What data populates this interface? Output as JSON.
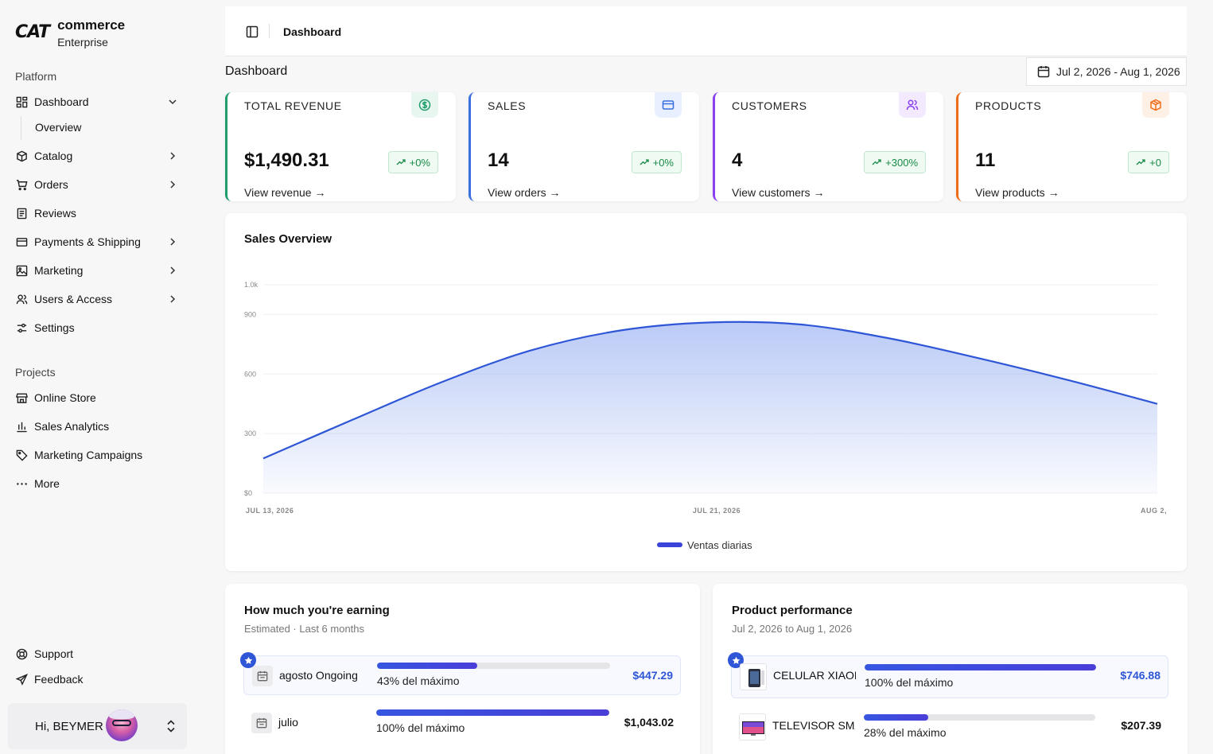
{
  "brand": {
    "mark": "CAT",
    "title": "commerce",
    "subtitle": "Enterprise"
  },
  "sidebar": {
    "platform_label": "Platform",
    "platform_items": [
      {
        "label": "Dashboard",
        "icon": "layout-grid-icon",
        "chevron": "down"
      },
      {
        "label": "Catalog",
        "icon": "box-icon",
        "chevron": "right"
      },
      {
        "label": "Orders",
        "icon": "cart-icon",
        "chevron": "right"
      },
      {
        "label": "Reviews",
        "icon": "document-icon"
      },
      {
        "label": "Payments & Shipping",
        "icon": "credit-card-icon",
        "chevron": "right"
      },
      {
        "label": "Marketing",
        "icon": "image-icon",
        "chevron": "right"
      },
      {
        "label": "Users & Access",
        "icon": "users-icon",
        "chevron": "right"
      },
      {
        "label": "Settings",
        "icon": "settings-sliders-icon"
      }
    ],
    "dashboard_sub": "Overview",
    "projects_label": "Projects",
    "project_items": [
      {
        "label": "Online Store",
        "icon": "store-icon"
      },
      {
        "label": "Sales Analytics",
        "icon": "bar-chart-icon"
      },
      {
        "label": "Marketing Campaigns",
        "icon": "tag-icon"
      },
      {
        "label": "More",
        "icon": "ellipsis-icon"
      }
    ],
    "support": "Support",
    "feedback": "Feedback",
    "user_greeting": "Hi, BEYMER"
  },
  "header": {
    "breadcrumb": "Dashboard"
  },
  "page": {
    "title": "Dashboard",
    "date_range": "Jul 2, 2026 - Aug 1, 2026"
  },
  "kpis": [
    {
      "label": "TOTAL REVENUE",
      "value": "$1,490.31",
      "change": "+0%",
      "link": "View revenue →",
      "color": "#1f9d6b",
      "icon": "dollar-circle-icon"
    },
    {
      "label": "SALES",
      "value": "14",
      "change": "+0%",
      "link": "View orders →",
      "color": "#3a6fe0",
      "icon": "credit-card-icon"
    },
    {
      "label": "CUSTOMERS",
      "value": "4",
      "change": "+300%",
      "link": "View customers →",
      "color": "#8a3ff0",
      "icon": "users-icon"
    },
    {
      "label": "PRODUCTS",
      "value": "11",
      "change": "+0",
      "link": "View products →",
      "color": "#ef6d1a",
      "icon": "package-icon"
    }
  ],
  "chart_data": {
    "type": "area",
    "title": "Sales Overview",
    "x_ticks": [
      "JUL 13, 2026",
      "JUL 21, 2026",
      "AUG 2,"
    ],
    "y_ticks": [
      "$0",
      "300",
      "600",
      "900",
      "1.0k"
    ],
    "y_tick_values": [
      0,
      300,
      600,
      900,
      1050
    ],
    "ylim": [
      0,
      1050
    ],
    "series": [
      {
        "name": "Ventas diarias",
        "color": "#2e56d6",
        "x": [
          0,
          0.1,
          0.2,
          0.3,
          0.4,
          0.5,
          0.6,
          0.7,
          0.8,
          0.9,
          1.0
        ],
        "values": [
          175,
          370,
          560,
          720,
          820,
          860,
          850,
          780,
          680,
          570,
          450
        ]
      }
    ],
    "legend_position": "bottom-center",
    "grid": true
  },
  "earning": {
    "title": "How much you're earning",
    "subtitle": "Estimated · Last 6 months",
    "rows": [
      {
        "name": "agosto Ongoing",
        "percent": 43,
        "percent_label": "43% del máximo",
        "amount": "$447.29",
        "featured": true
      },
      {
        "name": "julio",
        "percent": 100,
        "percent_label": "100% del máximo",
        "amount": "$1,043.02",
        "featured": false
      }
    ]
  },
  "performance": {
    "title": "Product performance",
    "subtitle": "Jul 2, 2026 to Aug 1, 2026",
    "rows": [
      {
        "name": "CELULAR XIAOMI",
        "percent": 100,
        "percent_label": "100% del máximo",
        "amount": "$746.88",
        "featured": true
      },
      {
        "name": "TELEVISOR SMART",
        "percent": 28,
        "percent_label": "28% del máximo",
        "amount": "$207.39",
        "featured": false
      }
    ]
  }
}
